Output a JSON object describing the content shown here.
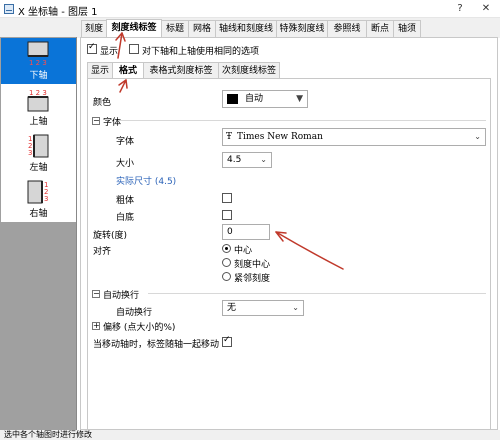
{
  "window": {
    "title": "X 坐标轴 - 图层 1"
  },
  "sidebar": {
    "items": [
      {
        "label": "下轴",
        "selected": true
      },
      {
        "label": "上轴",
        "selected": false
      },
      {
        "label": "左轴",
        "selected": false
      },
      {
        "label": "右轴",
        "selected": false
      }
    ],
    "icon_digits": [
      "1",
      "2",
      "3"
    ]
  },
  "tabs": [
    "刻度",
    "刻度线标签",
    "标题",
    "网格",
    "轴线和刻度线",
    "特殊刻度线",
    "参照线",
    "断点",
    "轴须"
  ],
  "selected_tab": "刻度线标签",
  "top_options": {
    "show_label": "显示",
    "show_checked": true,
    "same_options_label": "对下轴和上轴使用相同的选项",
    "same_checked": false
  },
  "subtabs": [
    "显示",
    "格式",
    "表格式刻度标签",
    "次刻度线标签"
  ],
  "selected_subtab": "格式",
  "format": {
    "color_label": "颜色",
    "color_value": "自动",
    "color_swatch": "#000000",
    "font_group": "字体",
    "font_label": "字体",
    "font_value": "Times New Roman",
    "size_label": "大小",
    "size_value": "4.5",
    "actual_size_label": "实际尺寸 (4.5)",
    "bold_label": "粗体",
    "bold_checked": false,
    "white_bg_label": "白底",
    "white_bg_checked": false,
    "rotation_label": "旋转(度)",
    "rotation_value": "0",
    "align_label": "对齐",
    "align_options": [
      "中心",
      "刻度中心",
      "紧邻刻度"
    ],
    "align_selected": "中心",
    "autowrap_group": "自动换行",
    "autowrap_label": "自动换行",
    "autowrap_value": "无",
    "offset_group": "偏移 (点大小的%)",
    "move_with_axis_label": "当移动轴时，标签随轴一起移动",
    "move_with_axis_checked": true
  },
  "status": {
    "text": "选中各个轴图时进行修改"
  },
  "colors": {
    "accent": "#0a74d8",
    "annotation": "#c0392b"
  }
}
